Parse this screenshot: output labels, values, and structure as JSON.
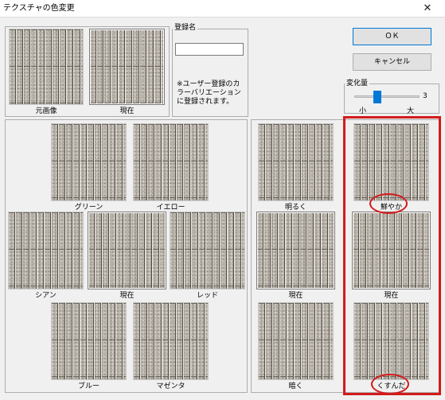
{
  "window": {
    "title": "テクスチャの色変更",
    "close_glyph": "✕"
  },
  "top_preview": {
    "original_label": "元画像",
    "current_label": "現在"
  },
  "register": {
    "group_title": "登録名",
    "name_value": "",
    "note": "※ユーザー登録のカラーバリエーションに登録されます。"
  },
  "buttons": {
    "ok_label": "ＯＫ",
    "cancel_label": "キャンセル"
  },
  "change_amount": {
    "group_title": "変化量",
    "value": "3",
    "min_label": "小",
    "max_label": "大",
    "level": 0.33
  },
  "hue_panel": {
    "green": "グリーン",
    "yellow": "イエロー",
    "cyan": "シアン",
    "current": "現在",
    "red": "レッド",
    "blue": "ブルー",
    "magenta": "マゼンタ"
  },
  "brightness_column": {
    "brighter": "明るく",
    "current": "現在",
    "darker": "暗く"
  },
  "saturation_column": {
    "vivid": "鮮やか",
    "current": "現在",
    "dull": "くすんだ"
  },
  "colors": {
    "annotation_red": "#d31b1b",
    "slider_thumb": "#0078d7"
  }
}
